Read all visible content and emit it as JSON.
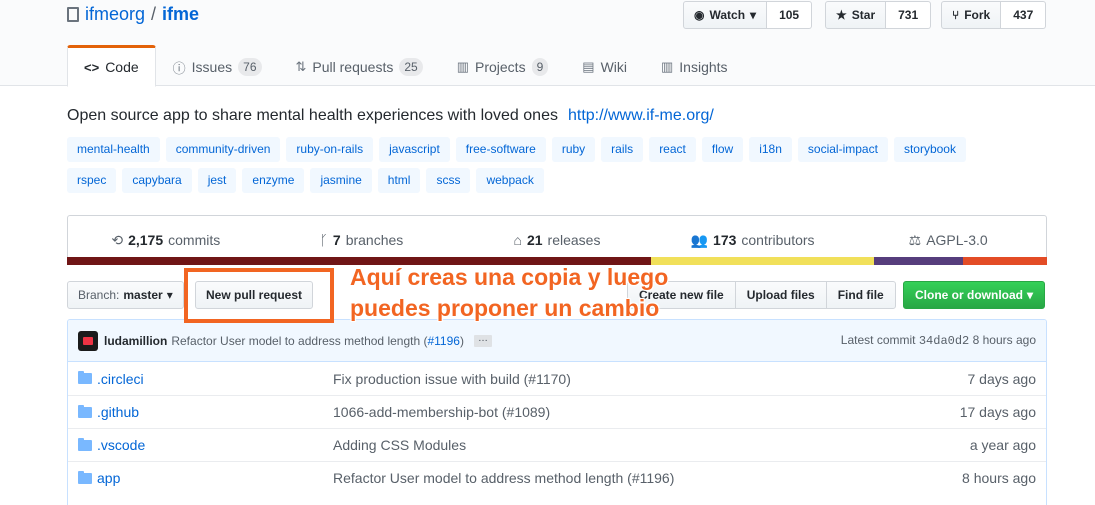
{
  "repo": {
    "owner": "ifmeorg",
    "separator": "/",
    "name": "ifme"
  },
  "social": {
    "watch": {
      "label": "Watch",
      "count": "105"
    },
    "star": {
      "label": "Star",
      "count": "731"
    },
    "fork": {
      "label": "Fork",
      "count": "437"
    }
  },
  "tabs": [
    {
      "label": "Code",
      "icon": "code-icon",
      "counter": ""
    },
    {
      "label": "Issues",
      "icon": "issue-icon",
      "counter": "76"
    },
    {
      "label": "Pull requests",
      "icon": "pull-request-icon",
      "counter": "25"
    },
    {
      "label": "Projects",
      "icon": "project-icon",
      "counter": "9"
    },
    {
      "label": "Wiki",
      "icon": "book-icon",
      "counter": ""
    },
    {
      "label": "Insights",
      "icon": "graph-icon",
      "counter": ""
    }
  ],
  "description": "Open source app to share mental health experiences with loved ones",
  "homepage": "http://www.if-me.org/",
  "topics_row1": [
    "mental-health",
    "community-driven",
    "ruby-on-rails",
    "javascript",
    "free-software",
    "ruby",
    "rails",
    "react",
    "flow",
    "i18n",
    "social-impact",
    "storybook"
  ],
  "topics_row2": [
    "rspec",
    "capybara",
    "jest",
    "enzyme",
    "jasmine",
    "html",
    "scss",
    "webpack"
  ],
  "summary": {
    "commits": {
      "count": "2,175",
      "label": "commits"
    },
    "branches": {
      "count": "7",
      "label": "branches"
    },
    "releases": {
      "count": "21",
      "label": "releases"
    },
    "contributors": {
      "count": "173",
      "label": "contributors"
    },
    "license": "AGPL-3.0"
  },
  "language_colors": [
    "#701516",
    "#f1e05a",
    "#563d7c",
    "#e34c26"
  ],
  "language_shares": [
    0.596,
    0.227,
    0.091,
    0.086
  ],
  "filebar": {
    "branch_label": "Branch:",
    "branch_value": "master",
    "new_pr": "New pull request",
    "create_file": "Create new file",
    "upload_files": "Upload files",
    "find_file": "Find file",
    "clone": "Clone or download"
  },
  "annotation": {
    "line1": "Aquí creas una copia y luego",
    "line2": "puedes proponer un cambio"
  },
  "latest_commit": {
    "author": "ludamillion",
    "message": "Refactor User model to address method length (",
    "pr": "#1196",
    "close": ")",
    "ellipsis": "…",
    "label": "Latest commit",
    "sha": "34da0d2",
    "age": "8 hours ago"
  },
  "files": [
    {
      "name": ".circleci",
      "message": "Fix production issue with build (#1170)",
      "age": "7 days ago"
    },
    {
      "name": ".github",
      "message": "1066-add-membership-bot (#1089)",
      "age": "17 days ago"
    },
    {
      "name": ".vscode",
      "message": "Adding CSS Modules",
      "age": "a year ago"
    },
    {
      "name": "app",
      "message": "Refactor User model to address method length (#1196)",
      "age": "8 hours ago"
    }
  ]
}
